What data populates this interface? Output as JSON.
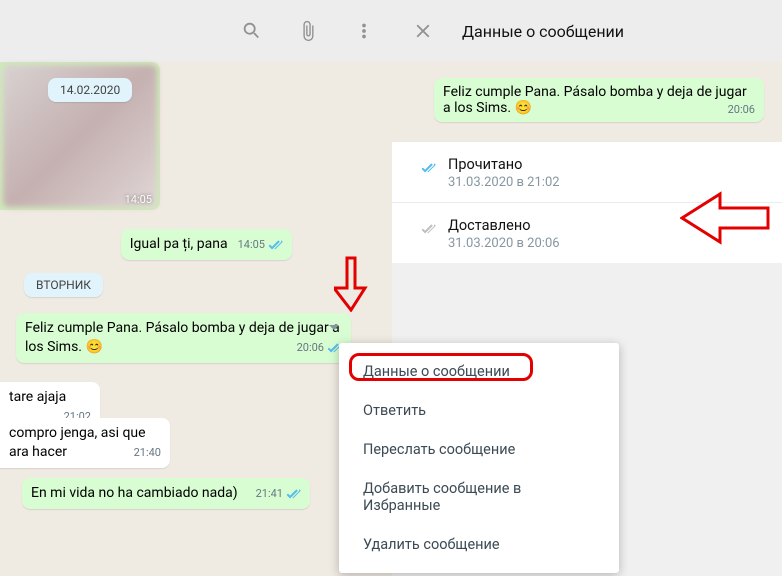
{
  "header": {},
  "dates": {
    "d1": "14.02.2020",
    "d2": "ВТОРНИК"
  },
  "media_time": "14:05",
  "msgs": {
    "m1": {
      "text": "Igual pa ți, pana",
      "time": "14:05"
    },
    "m2": {
      "text": "Feliz cumple Pana. Pásalo bomba y deja de jugar a los Sims. 😊",
      "time": "20:06"
    },
    "m3": {
      "text": "tare ajaja",
      "time": "21:02"
    },
    "m4": {
      "text": "compro jenga, asi que ara hacer",
      "time": "21:40"
    },
    "m5": {
      "text": "En  mi vida no ha cambiado nada)",
      "time": "21:41"
    }
  },
  "context_menu": {
    "info": "Данные о сообщении",
    "reply": "Ответить",
    "forward": "Переслать сообщение",
    "star": "Добавить сообщение в Избранные",
    "delete": "Удалить сообщение"
  },
  "info_panel": {
    "title": "Данные о сообщении",
    "bubble": "Feliz cumple Pana. Pásalo bomba y deja de jugar a los Sims. 😊",
    "bubble_time": "20:06",
    "read": {
      "label": "Прочитано",
      "time": "31.03.2020 в 21:02"
    },
    "delivered": {
      "label": "Доставлено",
      "time": "31.03.2020 в 20:06"
    }
  }
}
